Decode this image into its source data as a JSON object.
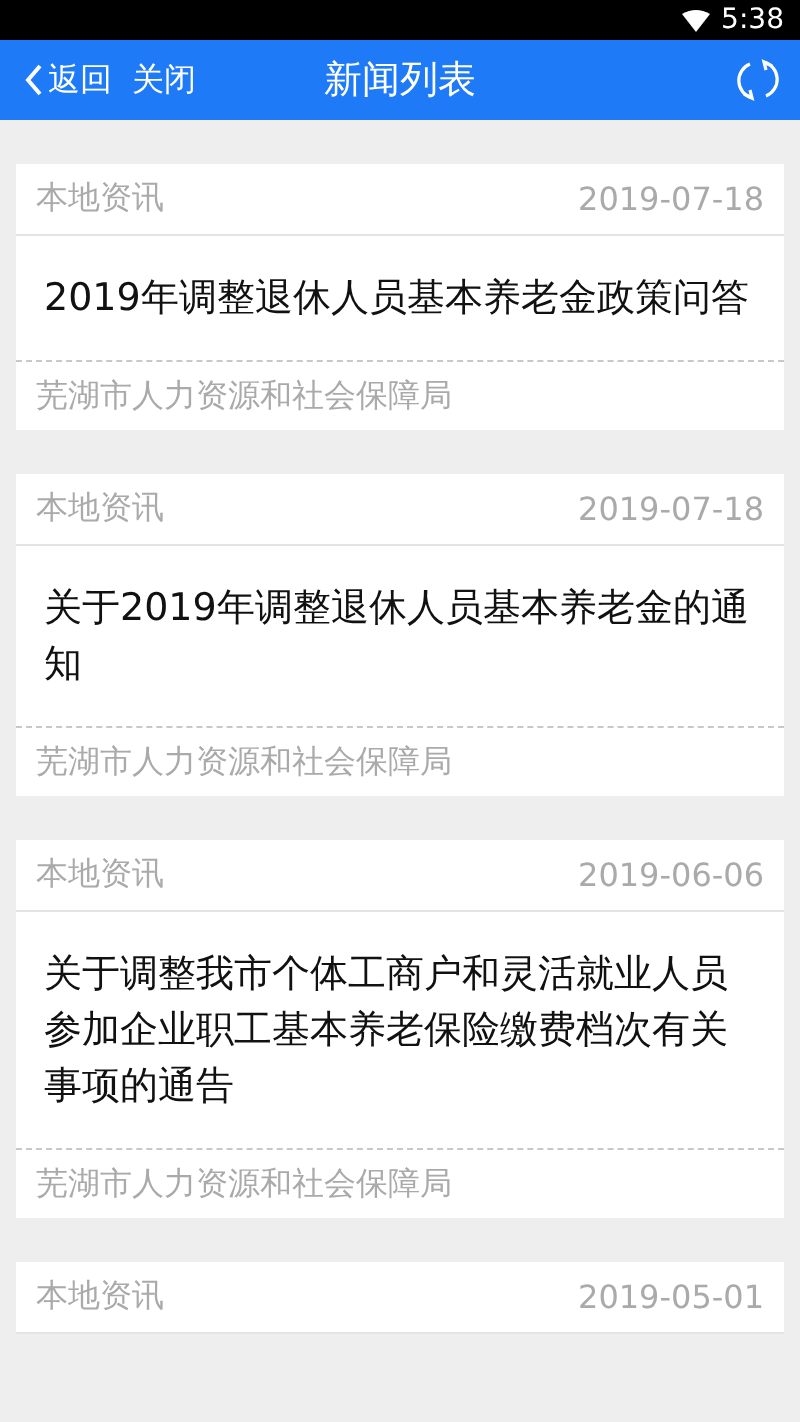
{
  "status_bar": {
    "time": "5:38"
  },
  "header": {
    "back": "返回",
    "close": "关闭",
    "title": "新闻列表"
  },
  "news": [
    {
      "category": "本地资讯",
      "date": "2019-07-18",
      "title": "2019年调整退休人员基本养老金政策问答",
      "source": "芜湖市人力资源和社会保障局"
    },
    {
      "category": "本地资讯",
      "date": "2019-07-18",
      "title": "关于2019年调整退休人员基本养老金的通知",
      "source": "芜湖市人力资源和社会保障局"
    },
    {
      "category": "本地资讯",
      "date": "2019-06-06",
      "title": "关于调整我市个体工商户和灵活就业人员参加企业职工基本养老保险缴费档次有关事项的通告",
      "source": "芜湖市人力资源和社会保障局"
    },
    {
      "category": "本地资讯",
      "date": "2019-05-01"
    }
  ]
}
